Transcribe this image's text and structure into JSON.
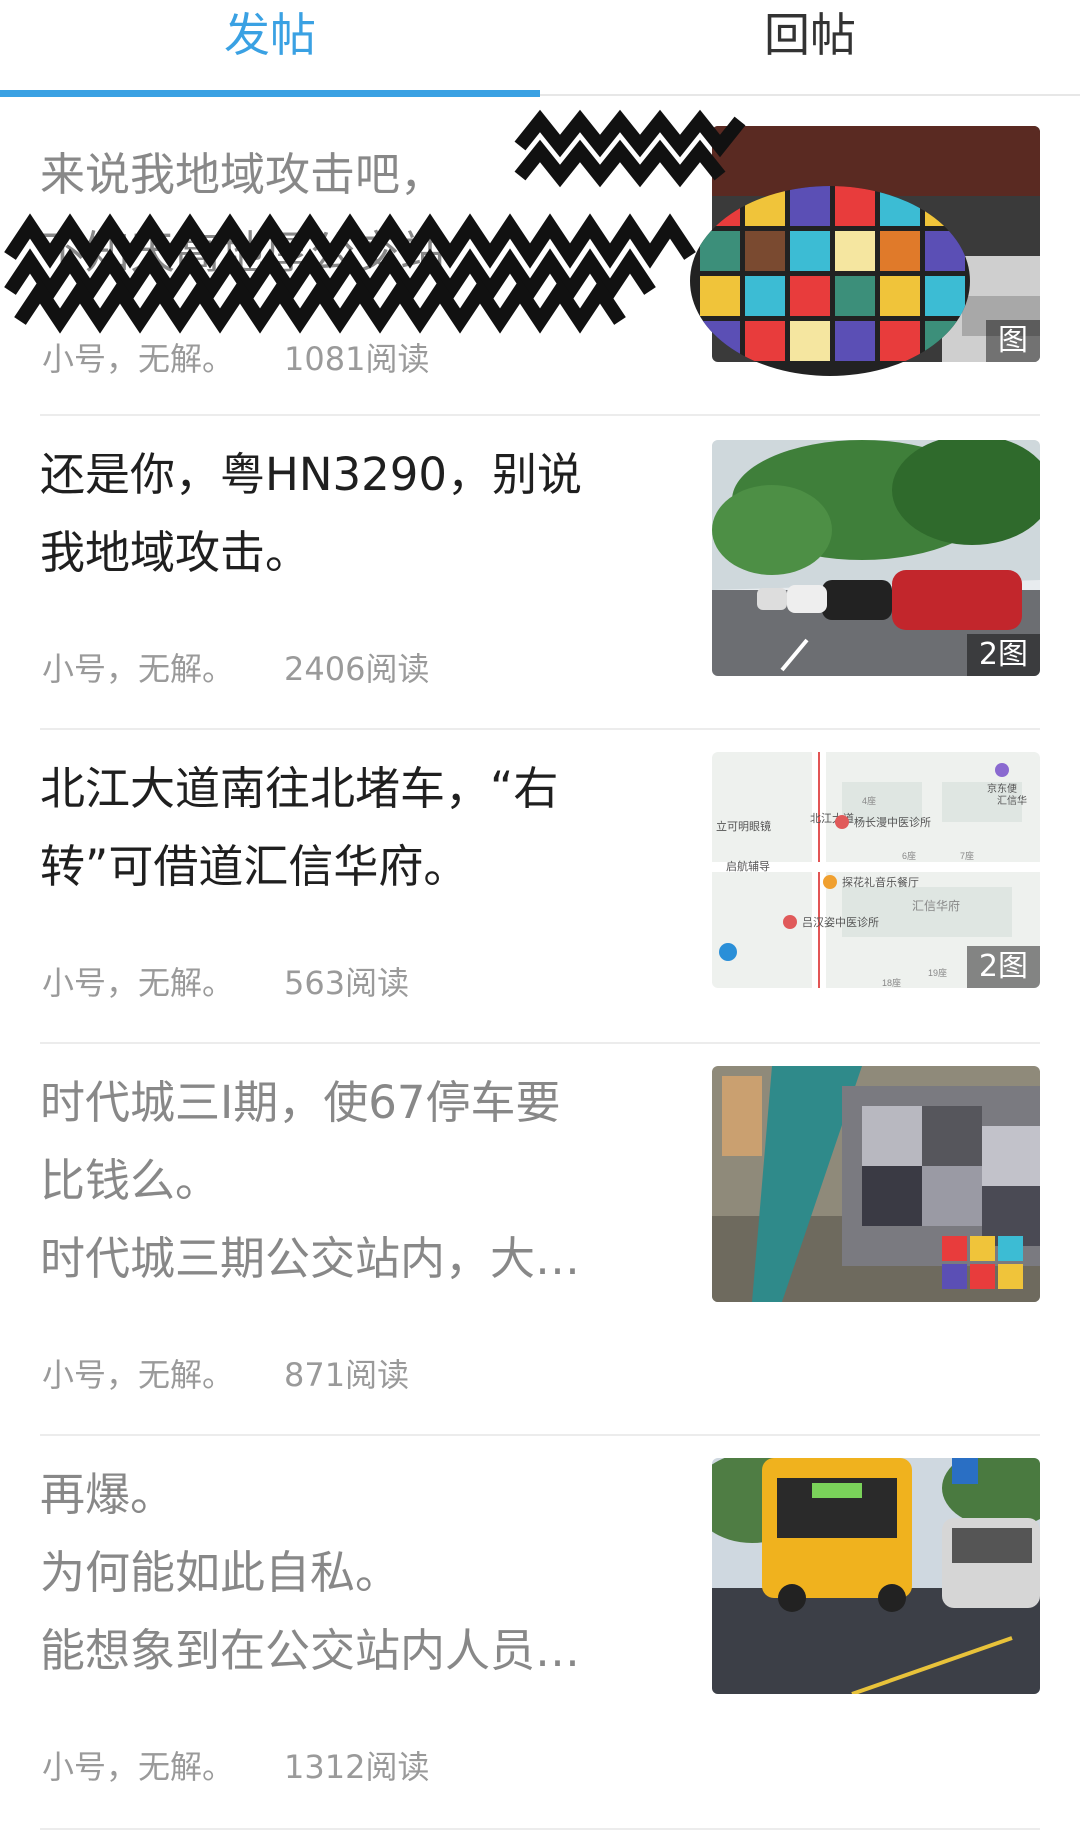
{
  "tabs": [
    {
      "label": "发帖",
      "active": true
    },
    {
      "label": "回帖",
      "active": false
    }
  ],
  "colors": {
    "accent": "#3aa1e3",
    "read_text": "#888888",
    "unread_text": "#1f1f1f",
    "meta_text": "#9a9a9a"
  },
  "posts": [
    {
      "lines": [
        "来说我地域攻击吧，",
        "不知天高地厚公交站"
      ],
      "read": true,
      "author": "小号，无解。",
      "reads": "1081阅读",
      "image_count": "图",
      "image_desc": "redacted-photo"
    },
    {
      "lines": [
        "还是你，粤HN3290，别说",
        "我地域攻击。"
      ],
      "read": false,
      "author": "小号，无解。",
      "reads": "2406阅读",
      "image_count": "2图",
      "image_desc": "street-parked-cars-photo"
    },
    {
      "lines": [
        "北江大道南往北堵车，“右",
        "转”可借道汇信华府。"
      ],
      "read": false,
      "author": "小号，无解。",
      "reads": "563阅读",
      "image_count": "2图",
      "image_desc": "map-screenshot",
      "map_labels": [
        "北江大道",
        "杨长漫中医诊所",
        "立可明眼镜",
        "启航辅导",
        "探花礼音乐餐厅",
        "汇信华府",
        "吕汉姿中医诊所",
        "京东便",
        "汇信华",
        "4座",
        "6座",
        "7座",
        "19座",
        "18座"
      ]
    },
    {
      "lines": [
        "时代城三I期，使67停车要",
        "比钱么。",
        "时代城三期公交站内，大…"
      ],
      "read": true,
      "author": "小号，无解。",
      "reads": "871阅读",
      "image_count": "",
      "image_desc": "bus-stop-blurred-photo"
    },
    {
      "lines": [
        "再爆。",
        "为何能如此自私。",
        "能想象到在公交站内人员…"
      ],
      "read": true,
      "author": "小号，无解。",
      "reads": "1312阅读",
      "image_count": "",
      "image_desc": "school-bus-street-photo"
    }
  ]
}
